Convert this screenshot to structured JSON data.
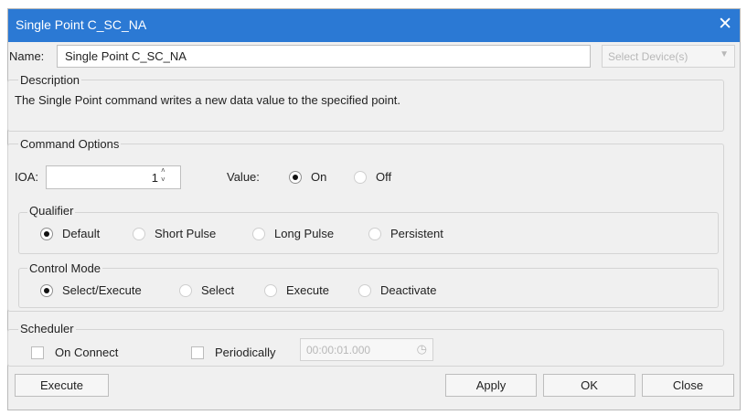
{
  "window": {
    "title": "Single Point C_SC_NA",
    "close_glyph": "✕"
  },
  "name": {
    "label": "Name:",
    "value": "Single Point C_SC_NA"
  },
  "select_device": {
    "label": "Select Device(s)",
    "arrow": "▼"
  },
  "description": {
    "title": "Description",
    "text": "The Single Point command writes a new data value to the specified point."
  },
  "command_options": {
    "title": "Command Options",
    "ioa_label": "IOA:",
    "ioa_value": "1",
    "spin_up": "˄",
    "spin_down": "˅",
    "value_label": "Value:",
    "value_options": [
      {
        "label": "On",
        "checked": true
      },
      {
        "label": "Off",
        "checked": false
      }
    ]
  },
  "qualifier": {
    "title": "Qualifier",
    "options": [
      {
        "label": "Default",
        "checked": true
      },
      {
        "label": "Short Pulse",
        "checked": false
      },
      {
        "label": "Long Pulse",
        "checked": false
      },
      {
        "label": "Persistent",
        "checked": false
      }
    ]
  },
  "control_mode": {
    "title": "Control Mode",
    "options": [
      {
        "label": "Select/Execute",
        "checked": true
      },
      {
        "label": "Select",
        "checked": false
      },
      {
        "label": "Execute",
        "checked": false
      },
      {
        "label": "Deactivate",
        "checked": false
      }
    ]
  },
  "scheduler": {
    "title": "Scheduler",
    "on_connect": "On Connect",
    "periodically": "Periodically",
    "period_value": "00:00:01.000",
    "clock_icon": "◷"
  },
  "buttons": {
    "execute": "Execute",
    "apply": "Apply",
    "ok": "OK",
    "close": "Close"
  },
  "colors": {
    "titlebar": "#2b79d4",
    "dialog_bg": "#f0f0f0"
  }
}
